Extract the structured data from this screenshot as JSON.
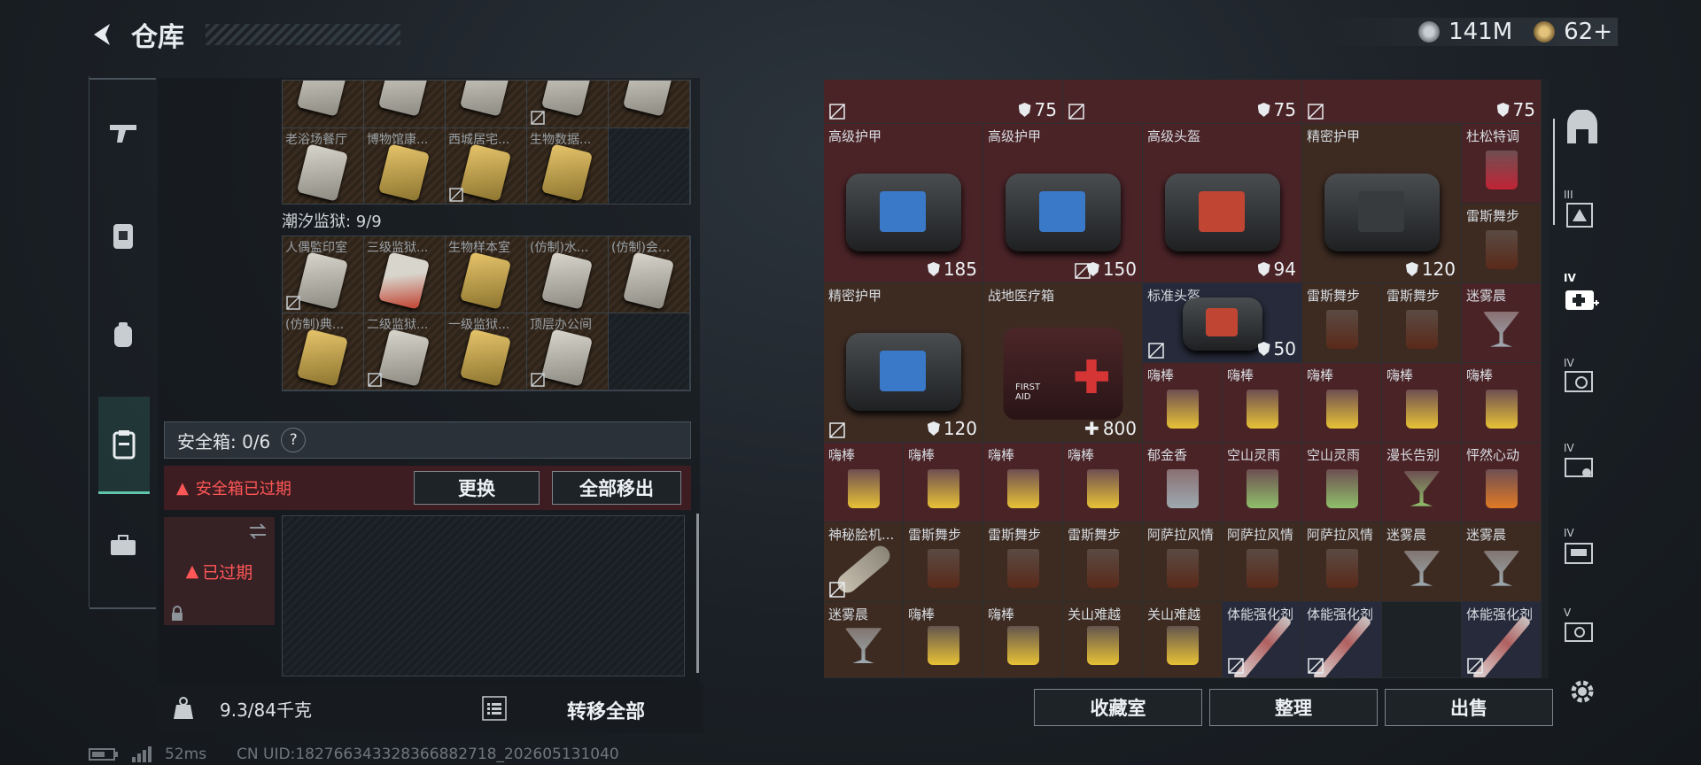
{
  "header": {
    "title": "仓库",
    "currency1": "141M",
    "currency2": "62+"
  },
  "left": {
    "top_rows": [
      [
        "老浴场餐厅",
        "博物馆康...",
        "西城居宅...",
        "生物数据...",
        ""
      ]
    ],
    "prison_label": "潮汐监狱: 9/9",
    "prison_rows": [
      [
        "人偶監印室",
        "三级监狱...",
        "生物样本室",
        "(仿制)水...",
        "(仿制)会..."
      ],
      [
        "(仿制)典...",
        "二级监狱...",
        "一级监狱...",
        "顶层办公间",
        ""
      ]
    ],
    "safebox_label": "安全箱: 0/6",
    "safebox_help": "?",
    "warning": "安全箱已过期",
    "replace_button": "更换",
    "remove_all_button": "全部移出",
    "expired_label": "已过期",
    "weight": "9.3/84千克",
    "transfer_all": "转移全部"
  },
  "status": {
    "ping": "52ms",
    "uid": "CN UID:182766343328366882718_202605131040"
  },
  "right": {
    "top_vals": [
      "75",
      "75",
      "75"
    ],
    "row1": [
      {
        "name": "高级护甲",
        "value": "185"
      },
      {
        "name": "高级护甲",
        "value": "150"
      },
      {
        "name": "高级头盔",
        "value": "94"
      },
      {
        "name": "精密护甲",
        "value": "120"
      },
      {
        "name": "杜松特调",
        "value": ""
      }
    ],
    "extra_drink": "雷斯舞步",
    "row2": [
      {
        "name": "精密护甲",
        "value": "120"
      },
      {
        "name": "战地医疗箱",
        "value": "800"
      },
      {
        "name": "标准头盔",
        "value": "50"
      }
    ],
    "row2_small": [
      "雷斯舞步",
      "雷斯舞步",
      "迷雾晨"
    ],
    "row2b_small": [
      "嗨棒",
      "嗨棒",
      "嗨棒",
      "嗨棒",
      "嗨棒"
    ],
    "first_aid_text": "FIRST AID",
    "row3": [
      "嗨棒",
      "嗨棒",
      "嗨棒",
      "嗨棒",
      "郁金香",
      "空山灵雨",
      "空山灵雨",
      "漫长告别",
      "怦然心动"
    ],
    "row4": [
      "神秘脍机...",
      "雷斯舞步",
      "雷斯舞步",
      "雷斯舞步",
      "阿萨拉风情",
      "阿萨拉风情",
      "阿萨拉风情",
      "迷雾晨",
      "迷雾晨"
    ],
    "row5": [
      "迷雾晨",
      "嗨棒",
      "嗨棒",
      "关山难越",
      "关山难越",
      "体能强化剂",
      "体能强化剂",
      "",
      "体能强化剂"
    ],
    "buttons": {
      "collection": "收藏室",
      "sort": "整理",
      "sell": "出售"
    },
    "nav_labels": [
      "III",
      "IV",
      "IV",
      "IV",
      "IV",
      "V"
    ]
  },
  "colors": {
    "accent": "#5fc6a8",
    "warning": "#ff5757",
    "red_cell": "#4a2327"
  }
}
